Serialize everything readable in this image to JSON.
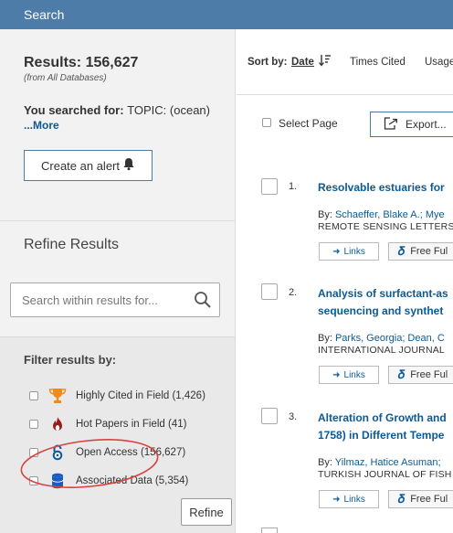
{
  "header": {
    "title": "Search"
  },
  "sidebar": {
    "results_label": "Results: 156,627",
    "results_source": "(from All Databases)",
    "searched_prefix": "You searched for: ",
    "searched_topic": "TOPIC:",
    "searched_query": " (ocean)",
    "more_link": "...More",
    "create_alert": "Create an alert",
    "refine_title": "Refine Results",
    "search_placeholder": "Search within results for...",
    "filter_title": "Filter results by:",
    "filters": [
      {
        "label": "Highly Cited in Field (1,426)",
        "icon": "trophy-icon"
      },
      {
        "label": "Hot Papers in Field (41)",
        "icon": "flame-icon"
      },
      {
        "label": "Open Access (156,627)",
        "icon": "open-access-icon"
      },
      {
        "label": "Associated Data (5,354)",
        "icon": "database-icon"
      }
    ],
    "refine_button": "Refine"
  },
  "sortbar": {
    "label": "Sort by:",
    "options": [
      "Date",
      "Times Cited",
      "Usage"
    ]
  },
  "toolbar": {
    "select_page": "Select Page",
    "export": "Export..."
  },
  "records": [
    {
      "num": "1.",
      "title_lines": [
        "Resolvable estuaries for"
      ],
      "authors_prefix": "By: ",
      "authors": "Schaeffer, Blake A.; Mye",
      "journal": "REMOTE SENSING LETTERS",
      "links": "Links",
      "free": "Free Ful"
    },
    {
      "num": "2.",
      "title_lines": [
        "Analysis of surfactant-as",
        "sequencing and synthet"
      ],
      "authors_prefix": "By: ",
      "authors": "Parks, Georgia; Dean, C",
      "journal": "INTERNATIONAL JOURNAL",
      "links": "Links",
      "free": "Free Ful"
    },
    {
      "num": "3.",
      "title_lines": [
        "Alteration of Growth and",
        "1758) in Different Tempe"
      ],
      "authors_prefix": "By: ",
      "authors": "Yilmaz, Hatice Asuman;",
      "journal": "TURKISH JOURNAL OF FISH",
      "links": "Links",
      "free": "Free Ful"
    }
  ],
  "colors": {
    "header_bg": "#4d7ca8",
    "link": "#0b5a96",
    "annotation_circle": "#d9413d"
  }
}
